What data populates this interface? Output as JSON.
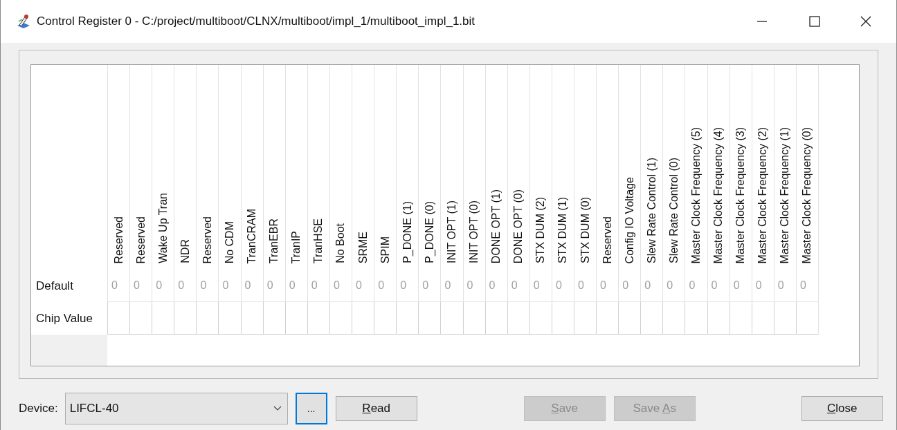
{
  "window": {
    "title": "Control Register 0 - C:/project/multiboot/CLNX/multiboot/impl_1/multiboot_impl_1.bit"
  },
  "table": {
    "row_headers": [
      "Default",
      "Chip Value"
    ],
    "columns": [
      {
        "label": "Reserved",
        "default": "0"
      },
      {
        "label": "Reserved",
        "default": "0"
      },
      {
        "label": "Wake Up Tran",
        "default": "0"
      },
      {
        "label": "NDR",
        "default": "0"
      },
      {
        "label": "Reserved",
        "default": "0"
      },
      {
        "label": "No CDM",
        "default": "0"
      },
      {
        "label": "TranCRAM",
        "default": "0"
      },
      {
        "label": "TranEBR",
        "default": "0"
      },
      {
        "label": "TranIP",
        "default": "0"
      },
      {
        "label": "TranHSE",
        "default": "0"
      },
      {
        "label": "No Boot",
        "default": "0"
      },
      {
        "label": "SRME",
        "default": "0"
      },
      {
        "label": "SPIM",
        "default": "0"
      },
      {
        "label": "P_DONE (1)",
        "default": "0"
      },
      {
        "label": "P_DONE (0)",
        "default": "0"
      },
      {
        "label": "INIT OPT (1)",
        "default": "0"
      },
      {
        "label": "INIT OPT (0)",
        "default": "0"
      },
      {
        "label": "DONE OPT (1)",
        "default": "0"
      },
      {
        "label": "DONE OPT (0)",
        "default": "0"
      },
      {
        "label": "STX DUM (2)",
        "default": "0"
      },
      {
        "label": "STX DUM (1)",
        "default": "0"
      },
      {
        "label": "STX DUM (0)",
        "default": "0"
      },
      {
        "label": "Reserved",
        "default": "0"
      },
      {
        "label": "Config IO Voltage",
        "default": "0"
      },
      {
        "label": "Slew Rate Control (1)",
        "default": "0"
      },
      {
        "label": "Slew Rate Control (0)",
        "default": "0"
      },
      {
        "label": "Master Clock Frequency (5)",
        "default": "0"
      },
      {
        "label": "Master Clock Frequency (4)",
        "default": "0"
      },
      {
        "label": "Master Clock Frequency (3)",
        "default": "0"
      },
      {
        "label": "Master Clock Frequency (2)",
        "default": "0"
      },
      {
        "label": "Master Clock Frequency (1)",
        "default": "0"
      },
      {
        "label": "Master Clock Frequency (0)",
        "default": "0"
      }
    ]
  },
  "device": {
    "label": "Device:",
    "value": "LIFCL-40"
  },
  "browse_button": {
    "label": "...",
    "focused": true
  },
  "buttons": [
    {
      "mnemonic": "R",
      "rest": "ead",
      "disabled": false
    },
    {
      "mnemonic": "S",
      "rest": "ave",
      "disabled": true
    },
    {
      "prefix": "Save ",
      "mnemonic": "A",
      "rest": "s",
      "disabled": true
    },
    {
      "mnemonic": "C",
      "rest": "lose",
      "disabled": false
    }
  ]
}
